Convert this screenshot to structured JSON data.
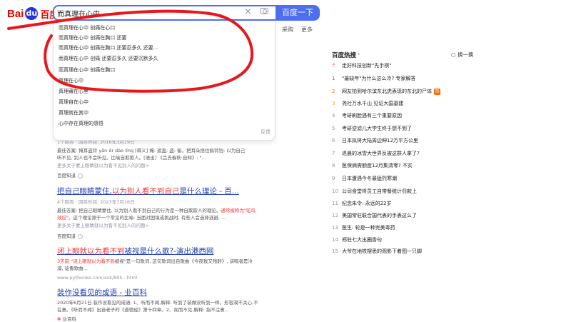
{
  "header": {
    "logo_bai": "Bai",
    "logo_paw": "du",
    "logo_cn": "百度",
    "search_value": "而真理在心中",
    "clear_icon": "×",
    "search_button": "百度一下",
    "tab_caigou": "采购",
    "tab_more": "更多"
  },
  "suggestions": [
    "而真理在心中 创痛在心口",
    "而真理在心中 创痛在胸口 还要",
    "而真理在心中 创痛在胸口 还要忍多久 还要...",
    "而真理在心中 创痛 还要忍多久 还要沉默多久",
    "而真理在心中 创痛在胸口",
    "真理在心中",
    "真理藏在心里",
    "真理自在心中",
    "真理就在其中",
    "心中存在真理的感悟"
  ],
  "suggest_feedback": "反馈",
  "results": [
    {
      "meta": "1个回答 · 回答时间: 2016年3月19日",
      "snippet1": "最佳答案: 掩耳盗铃 yǎn ěr dào líng [释义] 掩: 遮盖; 盗: 偷。把耳朵捂住偷铃铛: 以为自己",
      "snippet2": "听不见, 别人也不会听见。比喻自欺欺人。[语出] 《吕氏春秋·自知》: \"...",
      "more": "更多关于蒙上眼睛就以为看不见别人的问题>",
      "source": "百度知道"
    },
    {
      "title_a": "把自己眼睛蒙住",
      "title_b": "以为别人看不到自己",
      "title_c": "是什么理论 - 百...",
      "meta": "4个回答 · 回答时间: 2023年7月16日",
      "snippet1a": "最佳答案: 把自己眼睛蒙住, 以为别人看不到自己的行为是一种自欺欺人的理论。",
      "snippet1b": "通常被称为\"鸵鸟",
      "snippet2a": "效应",
      "snippet2b": "\"。这个理论源于一个常见的比喻: 当面对困境或挑战时, 有些人会选择逃避, ...",
      "more": "更多关于蒙上眼睛就以为看不见别人的问题>",
      "source": "百度知道"
    },
    {
      "title_a": "闭上眼就以为看不到",
      "title_b": "被视是什么歌?-演出港西网",
      "snippet1a": "3天前 \"闭上眼就以为看不到",
      "snippet1b": "被视\"是一句歌词, 这句歌词出自歌曲《今夜我又残醉》, 演唱者是冷",
      "snippet2": "漠, 徒鲁歌曲...",
      "url": "www.pythonke.com/ask/895...html"
    },
    {
      "title": "装作没看见的成语 - 业百科",
      "snippet1": "2020年6月21日 装作没看见的成语, 1、听而不闻,解释: 听到了装做没听到一样。形容漠不关心,不",
      "snippet2": "在意。《听而不闻》出自老子的《道德经》第十四章。2、视而不见,解释: 指不注意...",
      "source": "业百科"
    }
  ],
  "hot": {
    "title": "百度热搜",
    "arrow": "›",
    "refresh": "换一换",
    "items": [
      {
        "idx": "⇡",
        "text": "走好科技创新\"先手棋\""
      },
      {
        "idx": "1",
        "text": "\"最缺年\"为什么这么冷? 专家解答"
      },
      {
        "idx": "2",
        "text": "网友拍到哈尔滨东北虎表现的东北的尸体",
        "badge": "热"
      },
      {
        "idx": "3",
        "text": "尧社万水千山 见证大国基建"
      },
      {
        "idx": "4",
        "text": "考研刷脸遇有三个重要原因"
      },
      {
        "idx": "5",
        "text": "考研逆滤儿大学生终于想不到了"
      },
      {
        "idx": "6",
        "text": "日本拟将大陆周边伸12万平方公里"
      },
      {
        "idx": "7",
        "text": "退晨的冰雪大世界反被这群人拿了?"
      },
      {
        "idx": "8",
        "text": "医保病需额度12月集清零? 不实"
      },
      {
        "idx": "9",
        "text": "日本遭遇今冬最猛烈寒潮"
      },
      {
        "idx": "10",
        "text": "公司食堂将员工自带餐统计罚款上"
      },
      {
        "idx": "11",
        "text": "纪念朱令: 永远的22岁"
      },
      {
        "idx": "12",
        "text": "美国常驻联合国代表的手表这么了"
      },
      {
        "idx": "13",
        "text": "医生: 轮是一种完美毒药"
      },
      {
        "idx": "14",
        "text": "郑驻七大出圈香句"
      },
      {
        "idx": "15",
        "text": "大爷在地铁摆悉的观影下着图一只脚"
      }
    ]
  },
  "colors": {
    "brand_blue": "#4e6ef2",
    "link": "#2440b3",
    "highlight_red": "#f73131",
    "annotation_red": "#e8171c"
  }
}
